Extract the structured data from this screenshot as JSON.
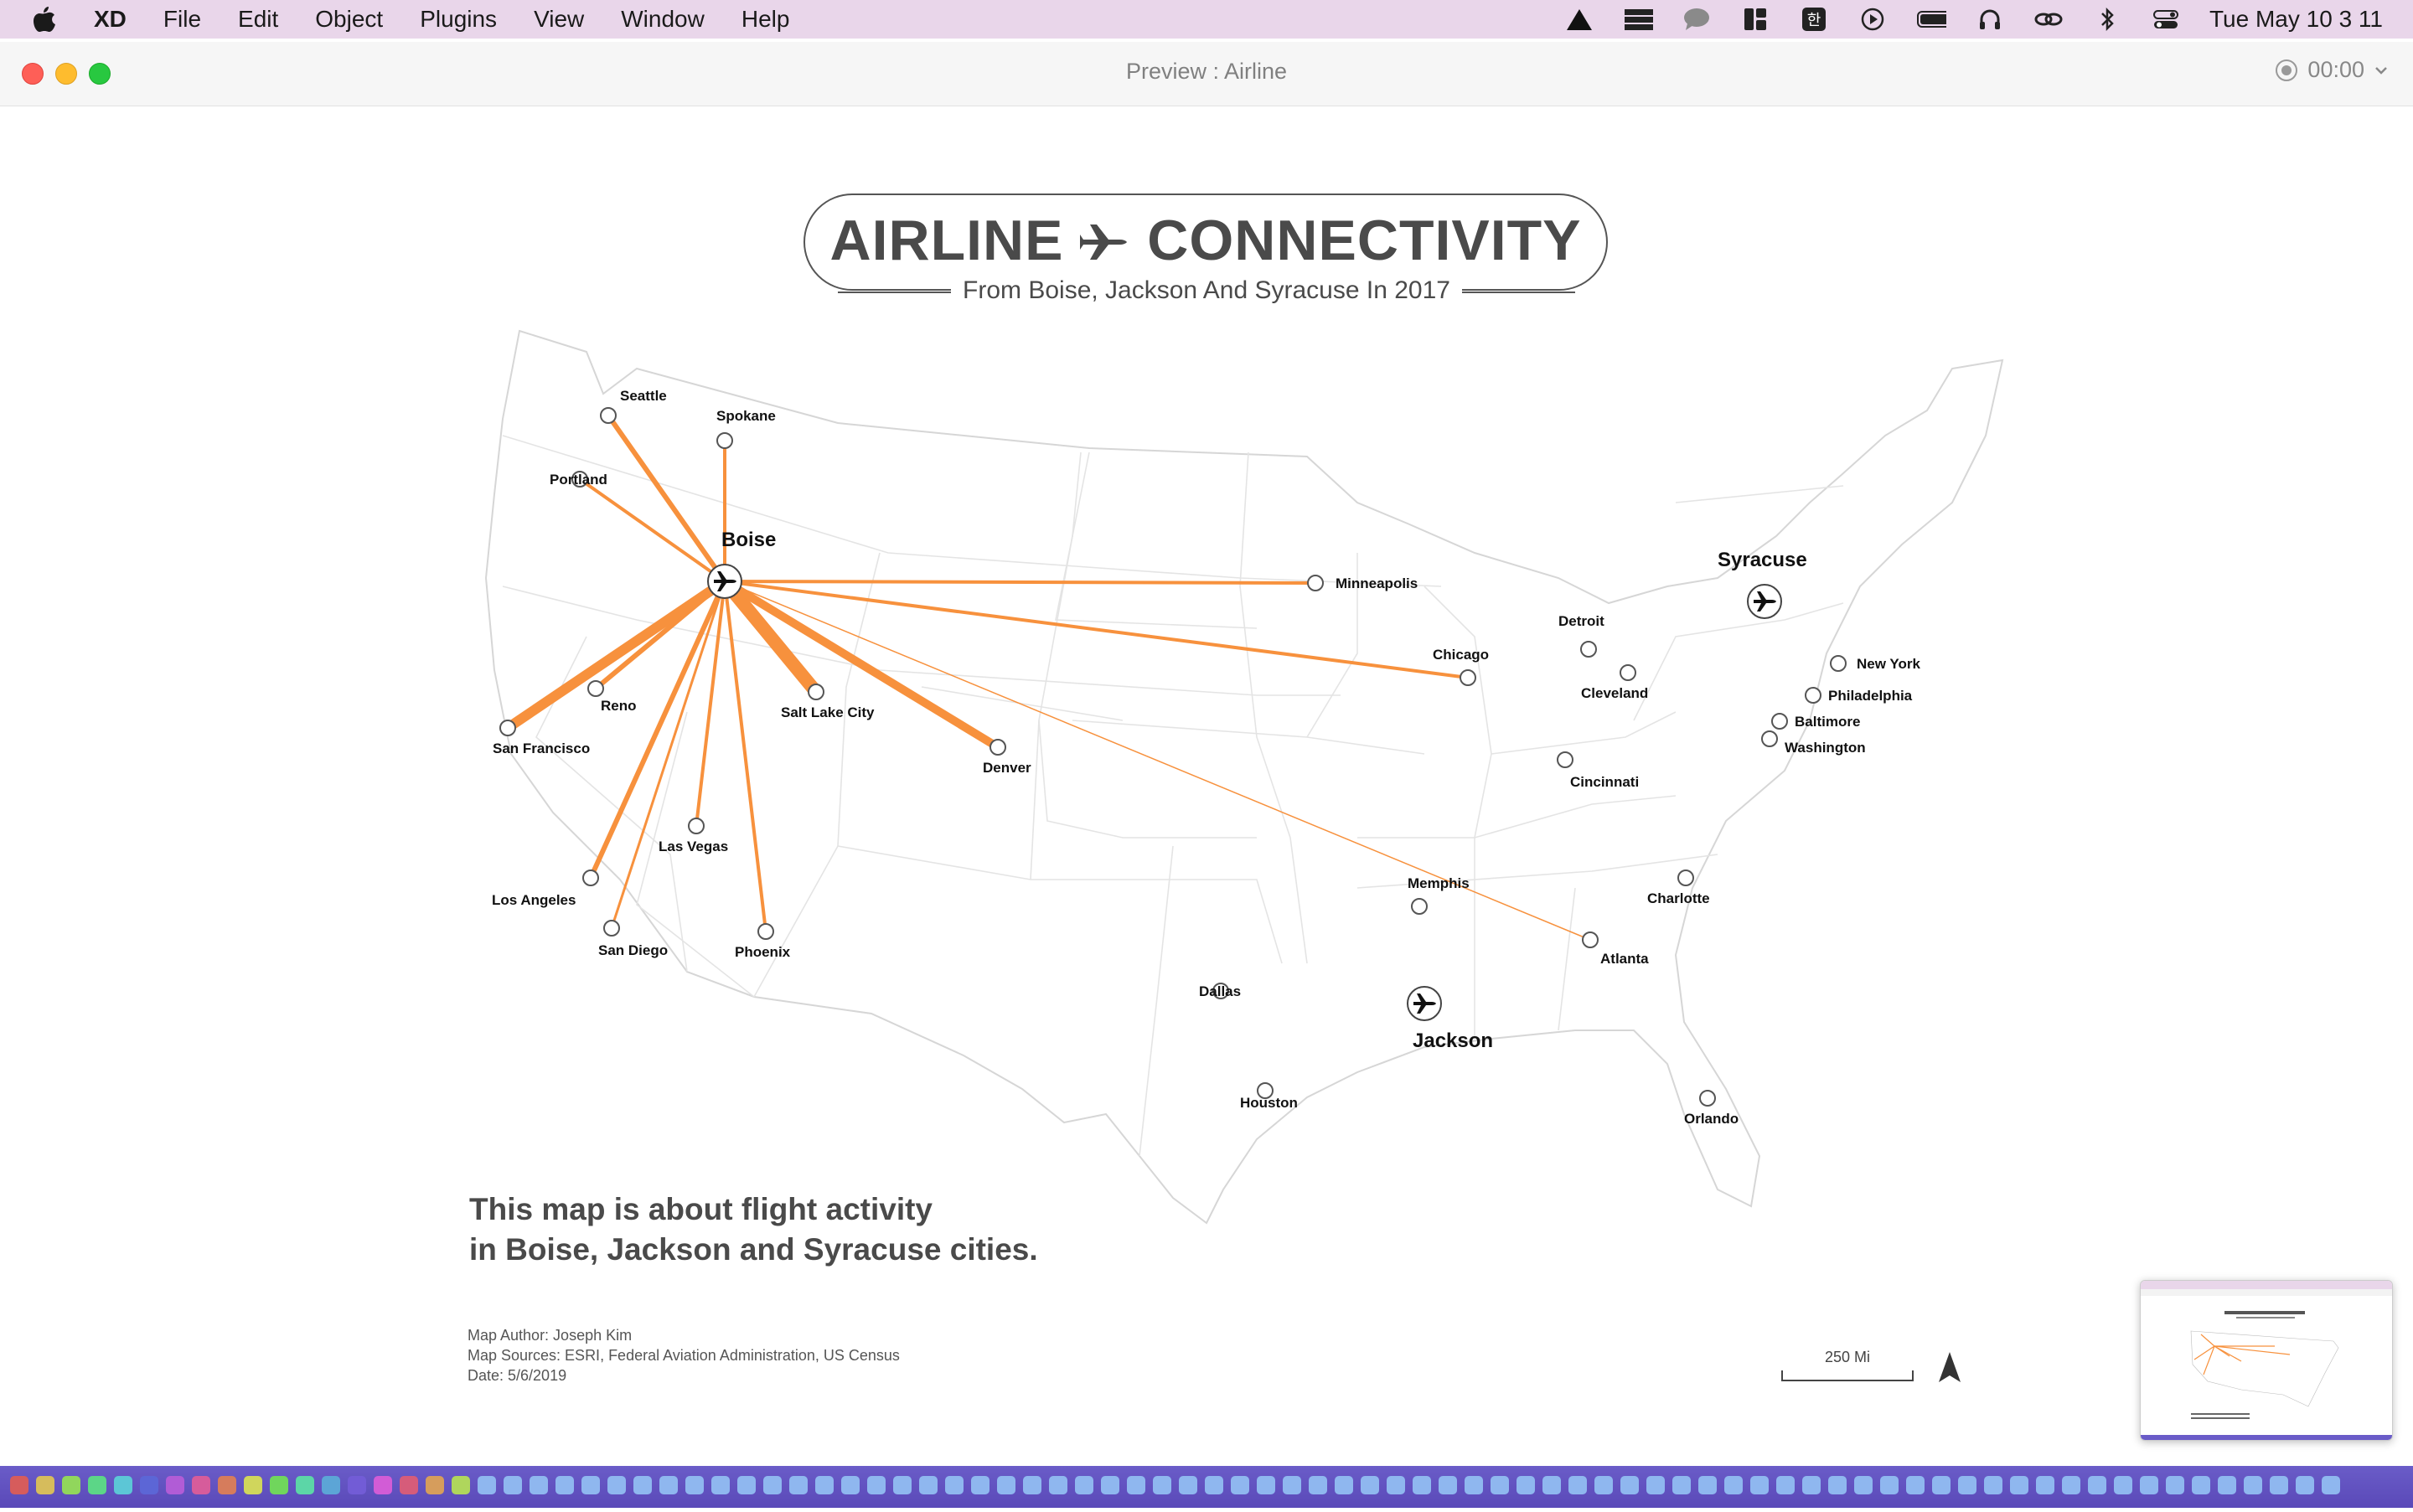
{
  "menubar": {
    "app_name": "XD",
    "items": [
      "File",
      "Edit",
      "Object",
      "Plugins",
      "View",
      "Window",
      "Help"
    ],
    "clock": "Tue May 10  3 11"
  },
  "window": {
    "title": "Preview : Airline",
    "record_time": "00:00"
  },
  "map": {
    "title_left": "AIRLINE",
    "title_right": "CONNECTIVITY",
    "subtitle": "From Boise, Jackson And Syracuse In 2017",
    "hubs": [
      "Boise",
      "Jackson",
      "Syracuse"
    ],
    "cities": [
      "Seattle",
      "Spokane",
      "Portland",
      "Reno",
      "San Francisco",
      "Salt Lake City",
      "Denver",
      "Las Vegas",
      "Los Angeles",
      "San Diego",
      "Phoenix",
      "Minneapolis",
      "Chicago",
      "Detroit",
      "Cleveland",
      "Cincinnati",
      "New York",
      "Philadelphia",
      "Baltimore",
      "Washington",
      "Memphis",
      "Charlotte",
      "Atlanta",
      "Dallas",
      "Houston",
      "Orlando"
    ],
    "description_line1": "This map is about flight activity",
    "description_line2": "in Boise, Jackson and Syracuse cities.",
    "author": "Map Author: Joseph Kim",
    "sources": "Map Sources: ESRI, Federal Aviation Administration, US Census",
    "date": "Date: 5/6/2019",
    "scale_label": "250 Mi",
    "route_color": "#f7913d"
  }
}
